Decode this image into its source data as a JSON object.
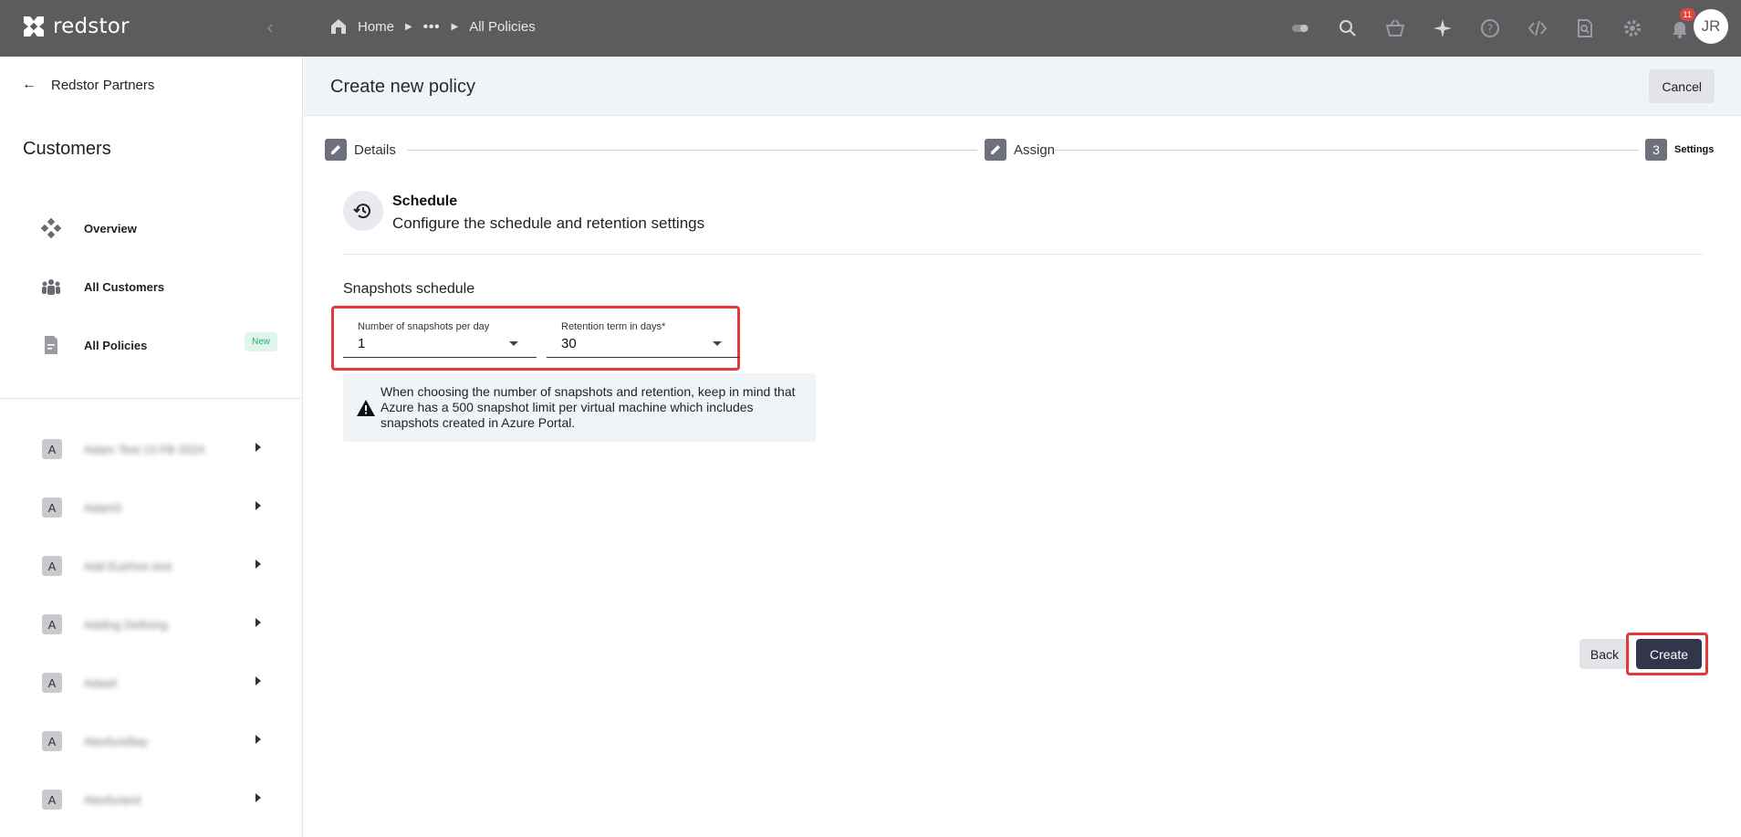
{
  "app": {
    "brand": "redstor"
  },
  "breadcrumb": {
    "home": "Home",
    "ellipsis": "•••",
    "current": "All Policies"
  },
  "topbar": {
    "icons": [
      "toggle-icon",
      "search-icon",
      "basket-icon",
      "sparkle-icon",
      "help-icon",
      "code-icon",
      "file-search-icon",
      "gear-icon",
      "bell-icon"
    ],
    "notification_count": "11",
    "avatar_initials": "JR"
  },
  "sidebar": {
    "back_label": "Redstor Partners",
    "title": "Customers",
    "nav": [
      {
        "label": "Overview",
        "icon": "overview-icon"
      },
      {
        "label": "All Customers",
        "icon": "people-icon"
      },
      {
        "label": "All Policies",
        "icon": "document-icon",
        "badge": "New"
      }
    ],
    "customers": [
      {
        "initial": "A",
        "name": "Adam Test 13 FB 2024"
      },
      {
        "initial": "A",
        "name": "Adam5"
      },
      {
        "initial": "A",
        "name": "Add Euirhon test"
      },
      {
        "initial": "A",
        "name": "Adding Defining"
      },
      {
        "initial": "A",
        "name": "Adaeli"
      },
      {
        "initial": "A",
        "name": "Aleefu/eBay"
      },
      {
        "initial": "A",
        "name": "Aleefu/and"
      }
    ]
  },
  "page": {
    "title": "Create new policy",
    "cancel_label": "Cancel",
    "steps": [
      {
        "label": "Details",
        "marker": "edit"
      },
      {
        "label": "Assign",
        "marker": "edit"
      },
      {
        "label": "Settings",
        "marker": "3"
      }
    ],
    "section": {
      "title": "Schedule",
      "subtitle": "Configure the schedule and retention settings"
    },
    "snapshots_label": "Snapshots schedule",
    "fields": {
      "snapshots_per_day": {
        "label": "Number of snapshots per day",
        "value": "1"
      },
      "retention_days": {
        "label": "Retention term in days*",
        "value": "30"
      }
    },
    "warning": "When choosing the number of snapshots and retention, keep in mind that Azure has a 500 snapshot limit per virtual machine which includes snapshots created in Azure Portal.",
    "back_label": "Back",
    "create_label": "Create"
  },
  "colors": {
    "topbar": "#5c5c5e",
    "highlight": "#e23a3a",
    "primary_button": "#33364a",
    "badge_new_text": "#2bab77",
    "notif_badge": "#e2453c"
  }
}
